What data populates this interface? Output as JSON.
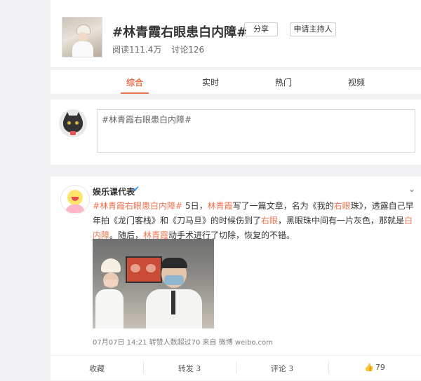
{
  "topic": {
    "title": "#林青霞右眼患白内障#",
    "reads": "阅读111.4万",
    "discussions": "讨论126",
    "share_label": "分享",
    "host_label": "申请主持人"
  },
  "tabs": [
    {
      "label": "综合",
      "active": true
    },
    {
      "label": "实时",
      "active": false
    },
    {
      "label": "热门",
      "active": false
    },
    {
      "label": "视频",
      "active": false
    }
  ],
  "composer": {
    "value": "#林青霞右眼患白内障#"
  },
  "post": {
    "author": "娱乐课代表",
    "verified_icon": "verified-v-icon",
    "more_icon": "chevron-down-icon",
    "text_segments": [
      {
        "text": "#林青霞右眼患白内障#",
        "hl": true
      },
      {
        "text": " 5日，",
        "hl": false
      },
      {
        "text": "林青霞",
        "hl": true
      },
      {
        "text": "写了一篇文章，名为《我的",
        "hl": false
      },
      {
        "text": "右眼",
        "hl": true
      },
      {
        "text": "珠》，透露自己早年拍《龙门客栈》和《刀马旦》的时候伤到了",
        "hl": false
      },
      {
        "text": "右眼",
        "hl": true
      },
      {
        "text": "，黑眼珠中间有一片灰色，那就是",
        "hl": false
      },
      {
        "text": "白内障",
        "hl": true
      },
      {
        "text": "。随后，",
        "hl": false
      },
      {
        "text": "林青霞",
        "hl": true
      },
      {
        "text": "动手术进行了切除，恢复的不错。",
        "hl": false
      }
    ],
    "meta": "07月07日 14:21 转赞人数超过70  来自 微博 weibo.com",
    "actions": {
      "collect": "收藏",
      "repost": "转发 3",
      "comment": "评论 3",
      "like": "79"
    }
  },
  "colors": {
    "accent": "#eb7350",
    "page_bg": "#f2f2f5",
    "verified": "#1e90ff"
  }
}
